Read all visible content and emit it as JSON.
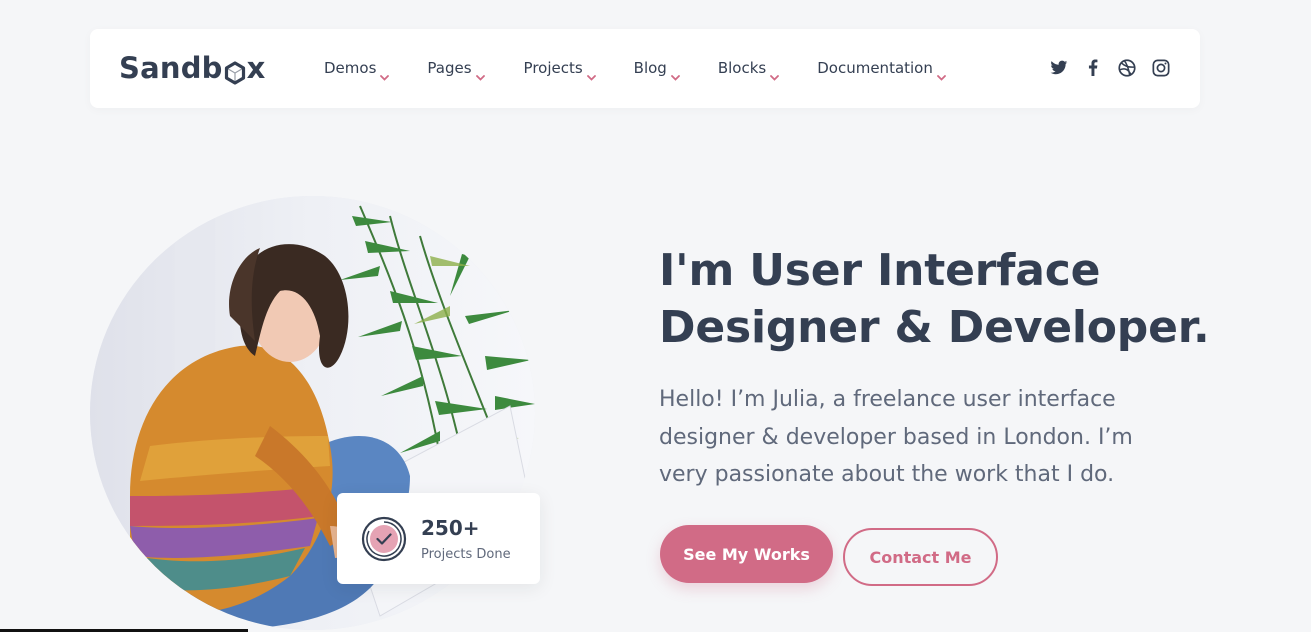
{
  "brand": {
    "logo_text_a": "Sandb",
    "logo_text_b": "x"
  },
  "nav": {
    "items": [
      {
        "label": "Demos"
      },
      {
        "label": "Pages"
      },
      {
        "label": "Projects"
      },
      {
        "label": "Blog"
      },
      {
        "label": "Blocks"
      },
      {
        "label": "Documentation"
      }
    ],
    "social": [
      "twitter-icon",
      "facebook-icon",
      "dribbble-icon",
      "instagram-icon"
    ]
  },
  "hero": {
    "headline_line1": "I'm User Interface",
    "headline_line2": "Designer & Developer.",
    "lead": "Hello! I’m Julia, a freelance user interface designer & developer based in London. I’m very passionate about the work that I do.",
    "primary_button": "See My Works",
    "secondary_button": "Contact Me"
  },
  "stat": {
    "value": "250+",
    "label": "Projects Done"
  },
  "colors": {
    "accent": "#d16b86",
    "heading": "#343f52",
    "body": "#60697b",
    "background": "#f5f6f8"
  }
}
